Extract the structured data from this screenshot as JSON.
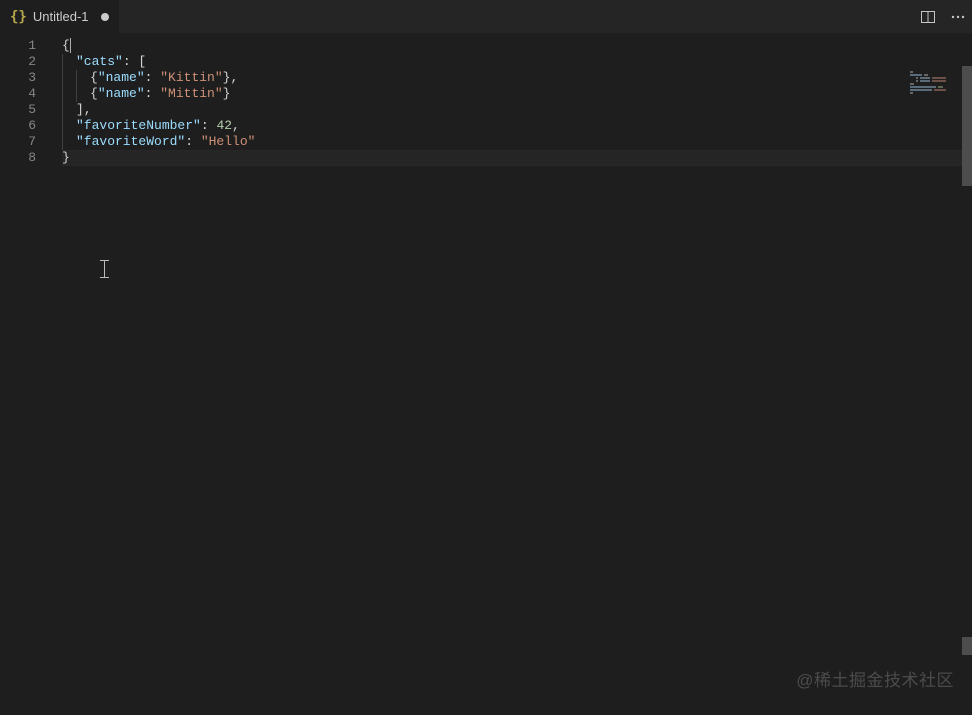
{
  "tab": {
    "icon_glyph": "{}",
    "title": "Untitled-1",
    "dirty": true
  },
  "actions": {
    "split": "split-editor",
    "more": "more-actions"
  },
  "gutter": {
    "lines": [
      "1",
      "2",
      "3",
      "4",
      "5",
      "6",
      "7",
      "8"
    ]
  },
  "code": {
    "lines": [
      {
        "segments": [
          {
            "t": "{",
            "c": "brace"
          }
        ],
        "cursor": true
      },
      {
        "indent": 1,
        "segments": [
          {
            "t": "\"cats\"",
            "c": "key"
          },
          {
            "t": ": [",
            "c": "punc"
          }
        ]
      },
      {
        "indent": 2,
        "segments": [
          {
            "t": "{",
            "c": "brace"
          },
          {
            "t": "\"name\"",
            "c": "key"
          },
          {
            "t": ": ",
            "c": "punc"
          },
          {
            "t": "\"Kittin\"",
            "c": "str"
          },
          {
            "t": "},",
            "c": "punc"
          }
        ]
      },
      {
        "indent": 2,
        "segments": [
          {
            "t": "{",
            "c": "brace"
          },
          {
            "t": "\"name\"",
            "c": "key"
          },
          {
            "t": ": ",
            "c": "punc"
          },
          {
            "t": "\"Mittin\"",
            "c": "str"
          },
          {
            "t": "}",
            "c": "punc"
          }
        ]
      },
      {
        "indent": 1,
        "segments": [
          {
            "t": "],",
            "c": "punc"
          }
        ]
      },
      {
        "indent": 1,
        "segments": [
          {
            "t": "\"favoriteNumber\"",
            "c": "key"
          },
          {
            "t": ": ",
            "c": "punc"
          },
          {
            "t": "42",
            "c": "num"
          },
          {
            "t": ",",
            "c": "punc"
          }
        ]
      },
      {
        "indent": 1,
        "segments": [
          {
            "t": "\"favoriteWord\"",
            "c": "key"
          },
          {
            "t": ": ",
            "c": "punc"
          },
          {
            "t": "\"Hello\"",
            "c": "str"
          }
        ]
      },
      {
        "segments": [
          {
            "t": "}",
            "c": "brace"
          }
        ],
        "highlight": true
      }
    ]
  },
  "watermark": "@稀土掘金技术社区",
  "colors": {
    "background": "#1e1e1e",
    "key": "#9cdcfe",
    "string": "#ce9178",
    "number": "#b5cea8"
  }
}
